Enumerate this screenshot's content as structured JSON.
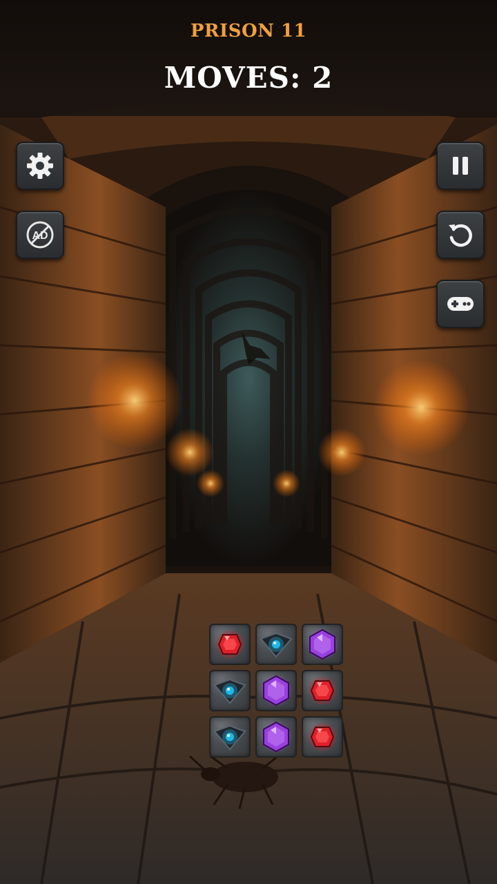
{
  "header": {
    "level_title": "PRISON 11",
    "moves_text": "MOVES: 2"
  },
  "buttons": {
    "settings": "gear-icon",
    "no_ads": "no-ads-icon",
    "no_ads_label": "AD",
    "pause": "pause-icon",
    "restart": "restart-icon",
    "more_games": "gamepad-icon"
  },
  "board": {
    "rows": 3,
    "cols": 3,
    "cells": [
      [
        "red-gem",
        "blue-gem",
        "purple-gem"
      ],
      [
        "blue-gem",
        "purple-gem",
        "red-gem"
      ],
      [
        "blue-gem",
        "purple-gem",
        "red-gem"
      ]
    ]
  },
  "colors": {
    "title": "#f0a040",
    "moves": "#ffffff",
    "red_gem": "#e0202a",
    "blue_gem": "#20b8e8",
    "purple_gem": "#9a40e0"
  }
}
